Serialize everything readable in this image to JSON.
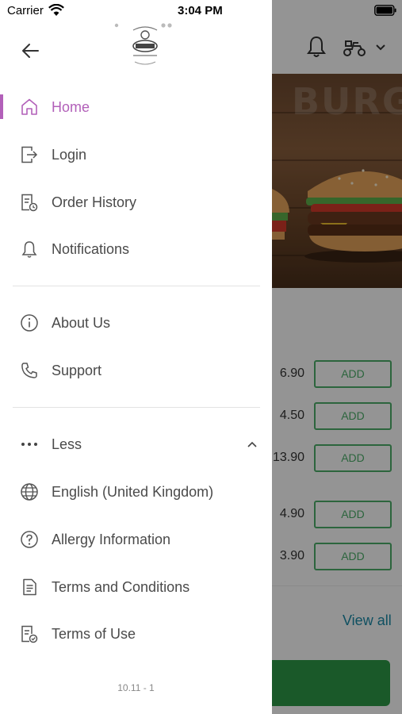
{
  "status_bar": {
    "carrier": "Carrier",
    "time": "3:04 PM"
  },
  "drawer": {
    "menu_primary": [
      {
        "label": "Home",
        "icon": "home-icon",
        "active": true
      },
      {
        "label": "Login",
        "icon": "login-icon"
      },
      {
        "label": "Order History",
        "icon": "order-history-icon"
      },
      {
        "label": "Notifications",
        "icon": "bell-icon"
      }
    ],
    "menu_secondary": [
      {
        "label": "About Us",
        "icon": "info-icon"
      },
      {
        "label": "Support",
        "icon": "phone-icon"
      }
    ],
    "more_toggle": {
      "label": "Less",
      "icon": "more-dots-icon",
      "state": "expanded"
    },
    "menu_more": [
      {
        "label": "English (United Kingdom)",
        "icon": "globe-icon"
      },
      {
        "label": "Allergy Information",
        "icon": "question-circle-icon"
      },
      {
        "label": "Terms and Conditions",
        "icon": "document-icon"
      },
      {
        "label": "Terms of Use",
        "icon": "document-check-icon"
      }
    ],
    "version": "10.11 - 1"
  },
  "background": {
    "banner_text": "BURG",
    "items": [
      {
        "price": "6.90",
        "button": "ADD"
      },
      {
        "price": "4.50",
        "button": "ADD"
      },
      {
        "price": "13.90",
        "button": "ADD"
      },
      {
        "price": "4.90",
        "button": "ADD"
      },
      {
        "price": "3.90",
        "button": "ADD"
      }
    ],
    "view_all": "View all"
  },
  "colors": {
    "accent": "#b260b9",
    "green": "#2e9a48",
    "link": "#1b8aa8"
  }
}
